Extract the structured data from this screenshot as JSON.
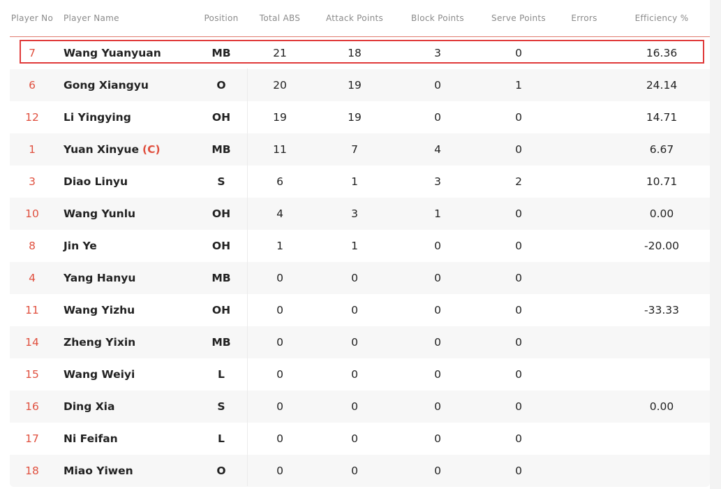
{
  "headers": {
    "no": "Player No",
    "name": "Player Name",
    "position": "Position",
    "total": "Total ABS",
    "attack": "Attack Points",
    "block": "Block Points",
    "serve": "Serve Points",
    "errors": "Errors",
    "efficiency": "Efficiency %"
  },
  "captain_marker": "(C)",
  "accent_color": "#e0503f",
  "rows": [
    {
      "no": "7",
      "name": "Wang Yuanyuan",
      "captain": false,
      "position": "MB",
      "total": "21",
      "attack": "18",
      "block": "3",
      "serve": "0",
      "errors": "",
      "efficiency": "16.36",
      "highlighted": true
    },
    {
      "no": "6",
      "name": "Gong Xiangyu",
      "captain": false,
      "position": "O",
      "total": "20",
      "attack": "19",
      "block": "0",
      "serve": "1",
      "errors": "",
      "efficiency": "24.14"
    },
    {
      "no": "12",
      "name": "Li Yingying",
      "captain": false,
      "position": "OH",
      "total": "19",
      "attack": "19",
      "block": "0",
      "serve": "0",
      "errors": "",
      "efficiency": "14.71"
    },
    {
      "no": "1",
      "name": "Yuan Xinyue",
      "captain": true,
      "position": "MB",
      "total": "11",
      "attack": "7",
      "block": "4",
      "serve": "0",
      "errors": "",
      "efficiency": "6.67"
    },
    {
      "no": "3",
      "name": "Diao Linyu",
      "captain": false,
      "position": "S",
      "total": "6",
      "attack": "1",
      "block": "3",
      "serve": "2",
      "errors": "",
      "efficiency": "10.71"
    },
    {
      "no": "10",
      "name": "Wang Yunlu",
      "captain": false,
      "position": "OH",
      "total": "4",
      "attack": "3",
      "block": "1",
      "serve": "0",
      "errors": "",
      "efficiency": "0.00"
    },
    {
      "no": "8",
      "name": "Jin Ye",
      "captain": false,
      "position": "OH",
      "total": "1",
      "attack": "1",
      "block": "0",
      "serve": "0",
      "errors": "",
      "efficiency": "-20.00"
    },
    {
      "no": "4",
      "name": "Yang Hanyu",
      "captain": false,
      "position": "MB",
      "total": "0",
      "attack": "0",
      "block": "0",
      "serve": "0",
      "errors": "",
      "efficiency": ""
    },
    {
      "no": "11",
      "name": "Wang Yizhu",
      "captain": false,
      "position": "OH",
      "total": "0",
      "attack": "0",
      "block": "0",
      "serve": "0",
      "errors": "",
      "efficiency": "-33.33"
    },
    {
      "no": "14",
      "name": "Zheng Yixin",
      "captain": false,
      "position": "MB",
      "total": "0",
      "attack": "0",
      "block": "0",
      "serve": "0",
      "errors": "",
      "efficiency": ""
    },
    {
      "no": "15",
      "name": "Wang Weiyi",
      "captain": false,
      "position": "L",
      "total": "0",
      "attack": "0",
      "block": "0",
      "serve": "0",
      "errors": "",
      "efficiency": ""
    },
    {
      "no": "16",
      "name": "Ding Xia",
      "captain": false,
      "position": "S",
      "total": "0",
      "attack": "0",
      "block": "0",
      "serve": "0",
      "errors": "",
      "efficiency": "0.00"
    },
    {
      "no": "17",
      "name": "Ni Feifan",
      "captain": false,
      "position": "L",
      "total": "0",
      "attack": "0",
      "block": "0",
      "serve": "0",
      "errors": "",
      "efficiency": ""
    },
    {
      "no": "18",
      "name": "Miao Yiwen",
      "captain": false,
      "position": "O",
      "total": "0",
      "attack": "0",
      "block": "0",
      "serve": "0",
      "errors": "",
      "efficiency": ""
    }
  ]
}
